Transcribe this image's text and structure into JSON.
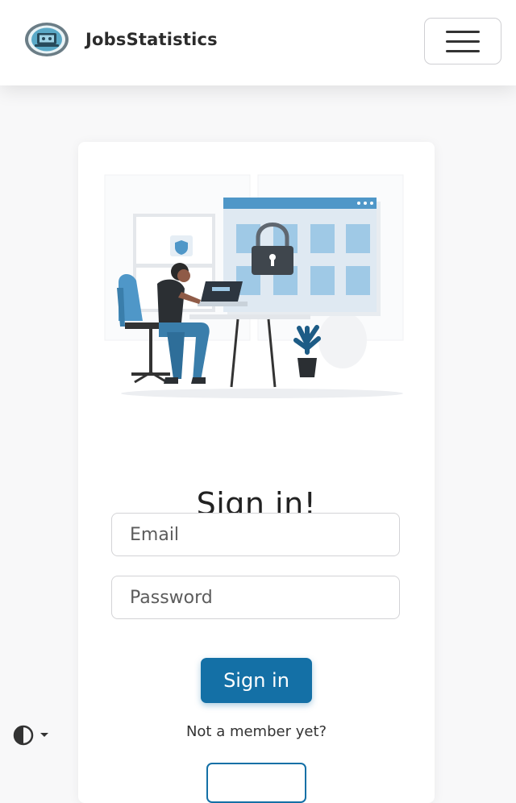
{
  "navbar": {
    "brand_name": "JobsStatistics",
    "logo_icon": "laptop-badge-logo-icon",
    "menu_icon": "hamburger-menu-icon"
  },
  "login": {
    "illustration_icon": "person-at-desk-with-lock-illustration",
    "title": "Sign in!",
    "email_placeholder": "Email",
    "password_placeholder": "Password",
    "signin_label": "Sign in",
    "not_member_text": "Not a member yet?"
  },
  "theme": {
    "toggle_icon": "half-circle-contrast-icon",
    "caret_icon": "caret-down-icon"
  },
  "colors": {
    "primary": "#1470a6",
    "illustration_blue": "#4f97c8",
    "light_blue": "#9fc9e6",
    "page_bg": "#f8f8f9"
  }
}
